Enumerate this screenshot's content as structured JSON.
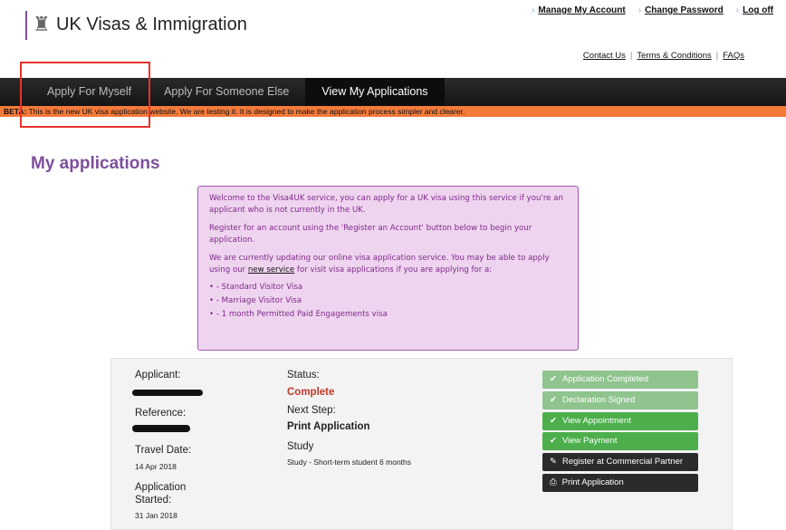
{
  "header": {
    "logo_text": "UK Visas & Immigration",
    "top_links": [
      "Manage My Account",
      "Change Password",
      "Log off"
    ],
    "sub_links": [
      "Contact Us",
      "Terms & Conditions",
      "FAQs"
    ]
  },
  "nav": {
    "tabs": [
      {
        "label": "Apply For Myself"
      },
      {
        "label": "Apply For Someone Else"
      },
      {
        "label": "View My Applications",
        "active": true
      }
    ]
  },
  "beta": {
    "label": "BETA:",
    "text": " This is the new UK visa application website. We are testing it. It is designed to make the application process simpler and clearer."
  },
  "page_title": "My applications",
  "info": {
    "p1": "Welcome to the Visa4UK service, you can apply for a UK visa using this service if you're an applicant who is not currently in the UK.",
    "p2": "Register for an account using the 'Register an Account' button below to begin your application.",
    "p3_pre": "We are currently updating our online visa application service. You may be able to apply using our ",
    "p3_link": "new service",
    "p3_post": " for visit visa applications if you are applying for a:",
    "items": [
      "- Standard Visitor Visa",
      "- Marriage Visitor Visa",
      "- 1 month Permitted Paid Engagements visa"
    ]
  },
  "application": {
    "applicant_label": "Applicant:",
    "reference_label": "Reference:",
    "travel_date_label": "Travel Date:",
    "travel_date": "14 Apr 2018",
    "started_label": "Application Started:",
    "started": "31 Jan 2018",
    "status_label": "Status:",
    "status": "Complete",
    "status_color": "#c0392b",
    "next_step_label": "Next Step:",
    "next_step": "Print Application",
    "category": "Study",
    "category_detail": "Study - Short-term student 6 months",
    "buttons": [
      {
        "label": "Application Completed",
        "icon": "check-icon"
      },
      {
        "label": "Declaration Signed",
        "icon": "check-icon"
      },
      {
        "label": "View Appointment",
        "icon": "check-icon"
      },
      {
        "label": "View Payment",
        "icon": "check-icon"
      },
      {
        "label": "Register at Commercial Partner",
        "icon": "pencil-icon"
      },
      {
        "label": "Print Application",
        "icon": "print-icon"
      }
    ]
  }
}
